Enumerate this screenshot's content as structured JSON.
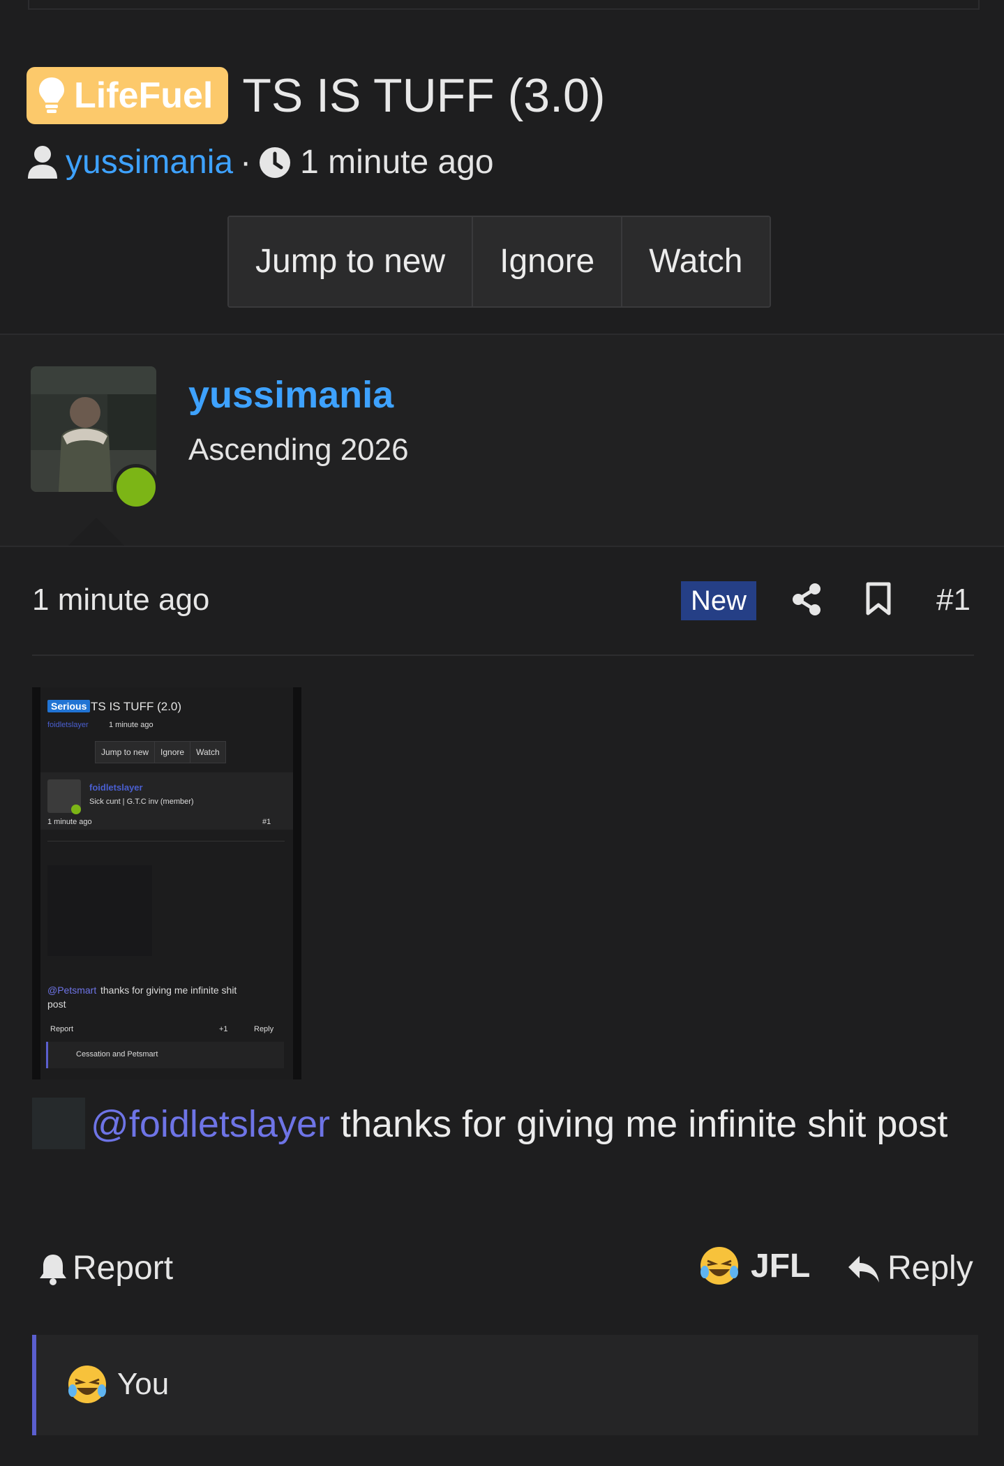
{
  "thread": {
    "prefix": "LifeFuel",
    "title": "TS IS TUFF (3.0)",
    "author": "yussimania",
    "separator": "·",
    "time": "1 minute ago"
  },
  "actions": {
    "jump": "Jump to new",
    "ignore": "Ignore",
    "watch": "Watch"
  },
  "user": {
    "name": "yussimania",
    "title": "Ascending 2026"
  },
  "post": {
    "time": "1 minute ago",
    "badge": "New",
    "number": "#1",
    "mention": "@foidletslayer",
    "text_rest": " thanks for giving me infinite shit post"
  },
  "embedded": {
    "badge": "Serious",
    "title": "TS IS TUFF (2.0)",
    "author": "foidletslayer",
    "time": "1 minute ago",
    "btn_jump": "Jump to new",
    "btn_ignore": "Ignore",
    "btn_watch": "Watch",
    "user_name": "foidletslayer",
    "user_title": "Sick cunt | G.T.C inv (member)",
    "post_time": "1 minute ago",
    "post_num": "#1",
    "mention": "@Petsmart",
    "text": " thanks for giving me infinite shit",
    "text2": "post",
    "report": "Report",
    "likes": "+1",
    "reply": "Reply",
    "reacts": "Cessation and Petsmart"
  },
  "footer": {
    "report": "Report",
    "reaction": "JFL",
    "reply": "Reply",
    "reacted_by": "You"
  },
  "colors": {
    "accent": "#3ea2ff",
    "prefix": "#fcc96b",
    "mention": "#6e74e6",
    "new_badge": "#253f86",
    "online": "#7cb516"
  }
}
